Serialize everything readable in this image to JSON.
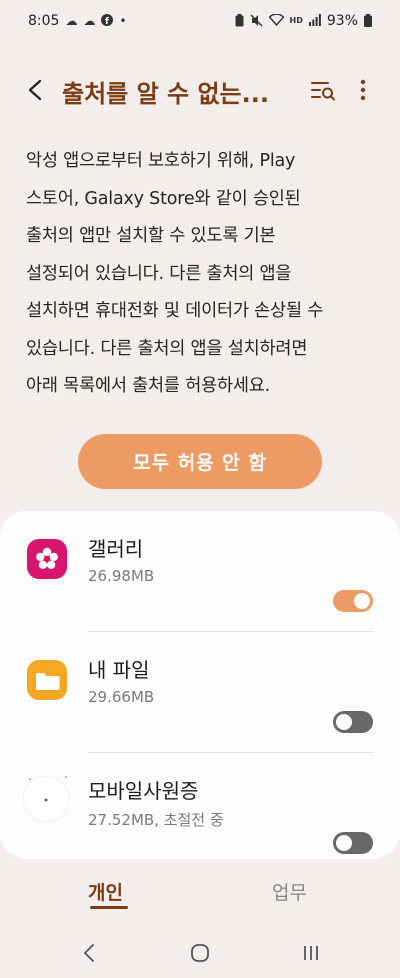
{
  "status_bar": {
    "time": "8:05",
    "left_icons": [
      "cloud-icon",
      "cloud-share-icon",
      "facebook-icon",
      "dot-icon"
    ],
    "right_icons": [
      "battery-saver-icon",
      "mute-icon",
      "wifi-icon",
      "hd-voice-icon",
      "signal-icon"
    ],
    "battery": "93%"
  },
  "header": {
    "title": "출처를 알 수 없는...",
    "icons": [
      "back-icon",
      "search-list-icon",
      "more-vertical-icon"
    ]
  },
  "description": "악성 앱으로부터 보호하기 위해, Play 스토어, Galaxy Store와 같이 승인된 출처의 앱만 설치할 수 있도록 기본 설정되어 있습니다. 다른 출처의 앱을 설치하면 휴대전화 및 데이터가 손상될 수 있습니다. 다른 출처의 앱을 설치하려면 아래 목록에서 출처를 허용하세요.",
  "description_lines": [
    "악성 앱으로부터 보호하기 위해, Play",
    "스토어, Galaxy Store와 같이 승인된",
    "출처의 앱만 설치할 수 있도록 기본",
    "설정되어 있습니다. 다른 출처의 앱을",
    "설치하면 휴대전화 및 데이터가 손상될 수",
    "있습니다. 다른 출처의 앱을 설치하려면",
    "아래 목록에서 출처를 허용하세요."
  ],
  "allow_none_button": "모두 허용 안 함",
  "apps": [
    {
      "name": "갤러리",
      "size": "26.98MB",
      "allowed": true,
      "icon": "gallery-icon",
      "icon_color": "#d8146c"
    },
    {
      "name": "내 파일",
      "size": "29.66MB",
      "allowed": false,
      "icon": "my-files-icon",
      "icon_color": "#f5a623"
    },
    {
      "name": "모바일사원증",
      "size": "27.52MB, 초절전 중",
      "allowed": false,
      "icon": "mobile-id-icon",
      "icon_color": "#ffffff"
    }
  ],
  "tabs": [
    {
      "label": "개인",
      "active": true
    },
    {
      "label": "업무",
      "active": false
    }
  ],
  "nav_icons": [
    "back-nav-icon",
    "home-nav-icon",
    "recents-nav-icon"
  ],
  "colors": {
    "accent": "#7c3b10",
    "button": "#ec9b64",
    "toggle_on": "#ec9b64",
    "toggle_off": "#6a6767",
    "background": "#f3eeec"
  }
}
